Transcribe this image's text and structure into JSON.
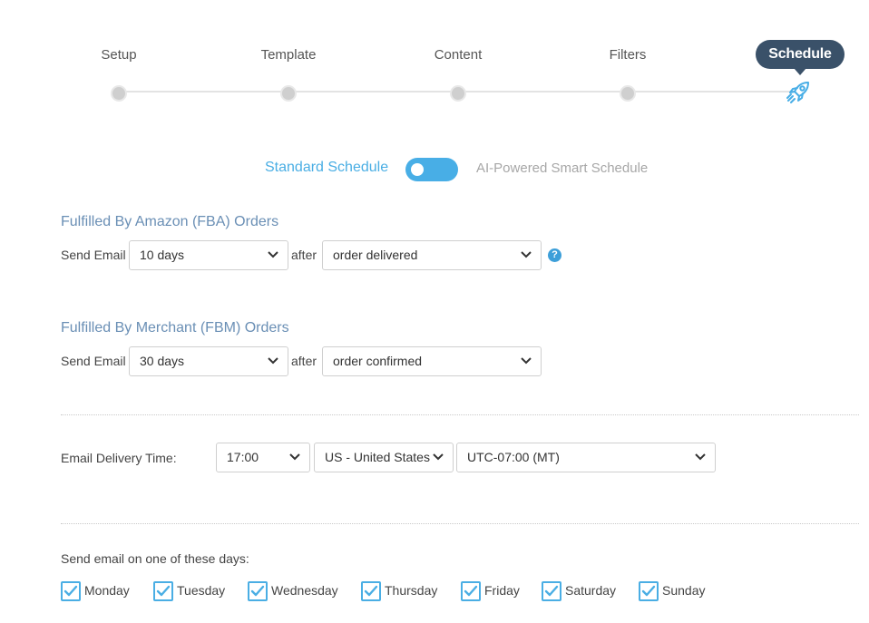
{
  "stepper": {
    "steps": [
      {
        "label": "Setup"
      },
      {
        "label": "Template"
      },
      {
        "label": "Content"
      },
      {
        "label": "Filters"
      }
    ],
    "active_label": "Schedule"
  },
  "schedule_toggle": {
    "left_label": "Standard Schedule",
    "right_label": "AI-Powered Smart Schedule"
  },
  "fba": {
    "title": "Fulfilled By Amazon (FBA) Orders",
    "send_label": "Send Email",
    "days_value": "10 days",
    "after_label": "after",
    "event_value": "order delivered",
    "help_glyph": "?"
  },
  "fbm": {
    "title": "Fulfilled By Merchant (FBM) Orders",
    "send_label": "Send Email",
    "days_value": "30 days",
    "after_label": "after",
    "event_value": "order confirmed"
  },
  "delivery": {
    "label": "Email Delivery Time:",
    "time_value": "17:00",
    "country_value": "US - United States",
    "timezone_value": "UTC-07:00 (MT)"
  },
  "days": {
    "label": "Send email on one of these days:",
    "items": [
      {
        "label": "Monday",
        "checked": true
      },
      {
        "label": "Tuesday",
        "checked": true
      },
      {
        "label": "Wednesday",
        "checked": true
      },
      {
        "label": "Thursday",
        "checked": true
      },
      {
        "label": "Friday",
        "checked": true
      },
      {
        "label": "Saturday",
        "checked": true
      },
      {
        "label": "Sunday",
        "checked": true
      }
    ]
  },
  "colors": {
    "accent": "#4aaee4",
    "section_title": "#6a8fb5",
    "active_step": "#3a5169"
  }
}
